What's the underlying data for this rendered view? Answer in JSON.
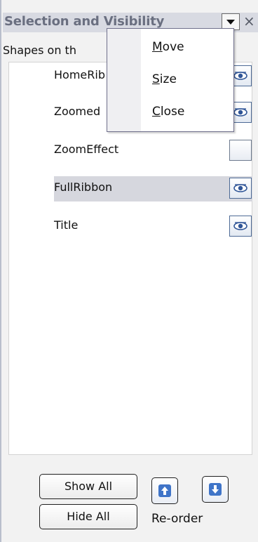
{
  "pane": {
    "title": "Selection and Visibility",
    "shapes_label": "Shapes on th"
  },
  "shapes": [
    {
      "name": "HomeRib",
      "visible": true
    },
    {
      "name": "Zoomed",
      "visible": true
    },
    {
      "name": "ZoomEffect",
      "visible": false
    },
    {
      "name": "FullRibbon",
      "visible": true,
      "selected": true
    },
    {
      "name": "Title",
      "visible": true
    }
  ],
  "menu": {
    "items": [
      {
        "label": "Move",
        "mnemonic": "M"
      },
      {
        "label": "Size",
        "mnemonic": "S"
      },
      {
        "label": "Close",
        "mnemonic": "C"
      }
    ]
  },
  "buttons": {
    "show_all": "Show All",
    "hide_all": "Hide All",
    "reorder_label": "Re-order"
  },
  "icons": {
    "pane_dropdown": "chevron-down-icon",
    "pane_close": "close-icon",
    "visibility": "eye-icon",
    "bring_forward": "arrow-up-icon",
    "send_backward": "arrow-down-icon"
  },
  "colors": {
    "title_bar": "#d8dae2",
    "selected_row": "#d6d7de",
    "eye_blue": "#2f5597"
  }
}
